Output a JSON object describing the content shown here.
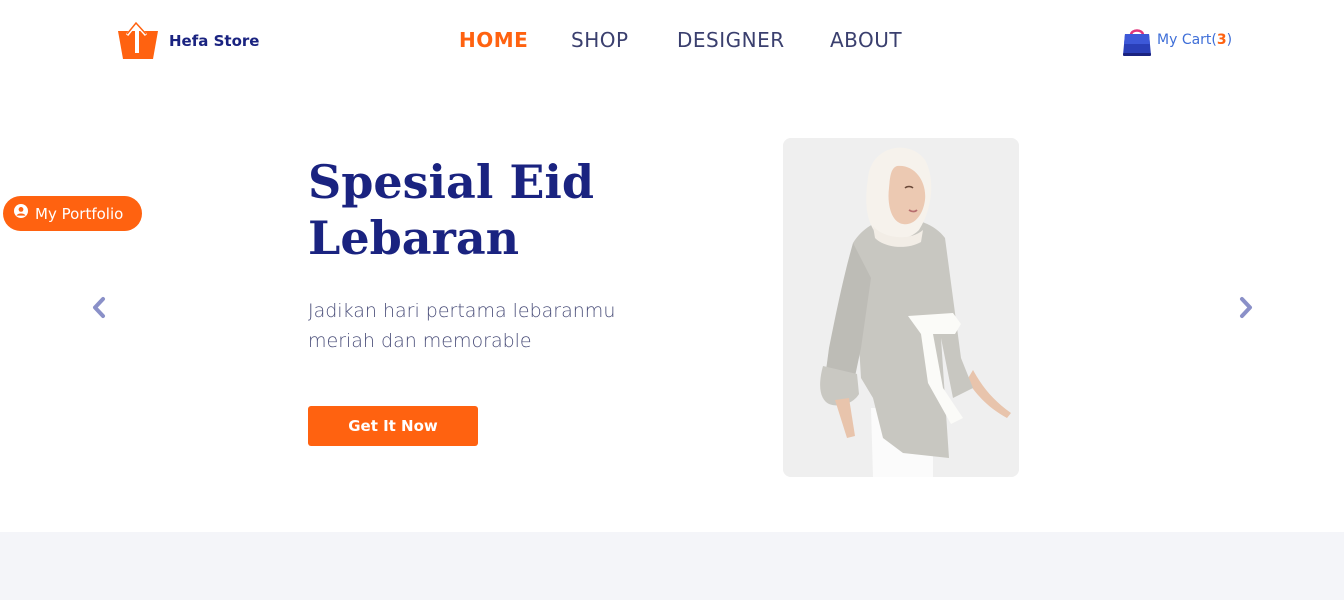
{
  "brand": {
    "name": "Hefa Store",
    "icon": "shopping-basket-icon",
    "accent": "#ff6210",
    "primary": "#1a2380"
  },
  "nav": {
    "items": [
      {
        "label": "HOME",
        "active": true
      },
      {
        "label": "SHOP",
        "active": false
      },
      {
        "label": "DESIGNER",
        "active": false
      },
      {
        "label": "ABOUT",
        "active": false
      }
    ]
  },
  "cart": {
    "label": "My Cart(",
    "count": "3",
    "suffix": ")",
    "icon": "shopping-bag-icon"
  },
  "portfolio": {
    "label": "My Portfolio",
    "icon": "user-circle-icon"
  },
  "hero": {
    "title": "Spesial Eid Lebaran",
    "subtitle": "Jadikan hari pertama lebaranmu meriah dan memorable",
    "cta_label": "Get It Now",
    "image": "woman-in-hijab-and-grey-blouse-photo"
  },
  "carousel": {
    "prev_icon": "chevron-left-icon",
    "next_icon": "chevron-right-icon"
  }
}
